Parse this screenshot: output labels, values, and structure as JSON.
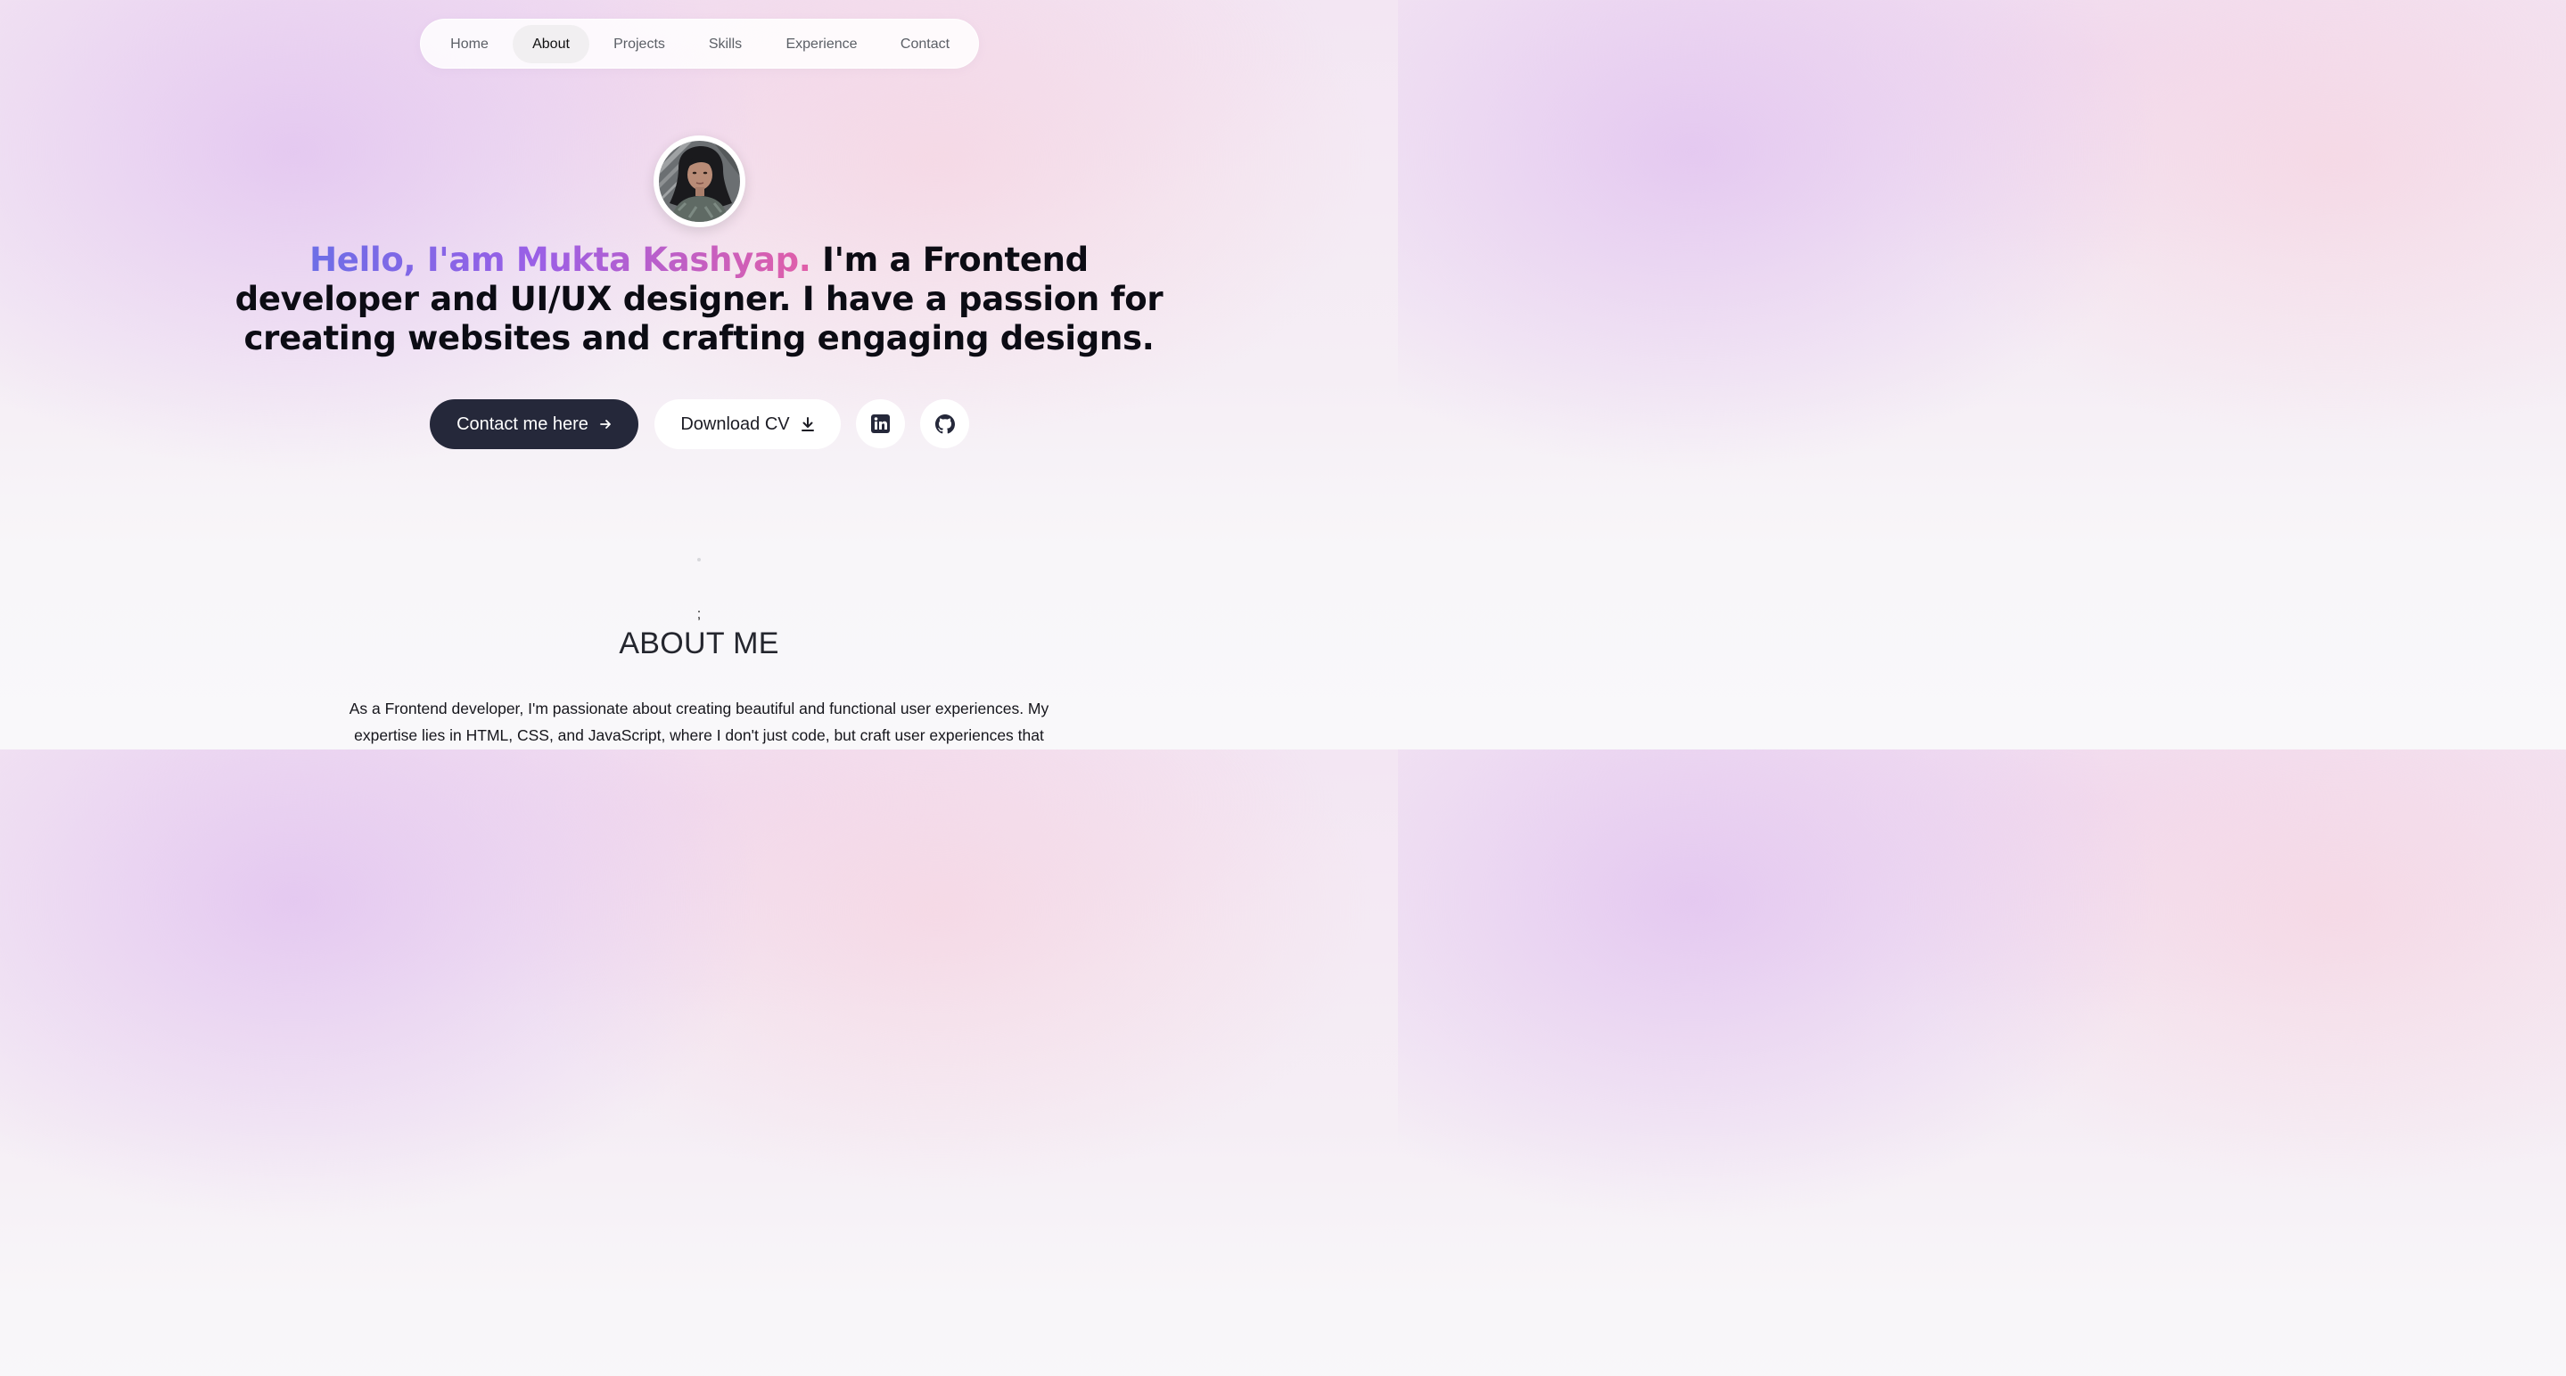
{
  "nav": {
    "items": [
      {
        "label": "Home"
      },
      {
        "label": "About",
        "active": true
      },
      {
        "label": "Projects"
      },
      {
        "label": "Skills"
      },
      {
        "label": "Experience"
      },
      {
        "label": "Contact"
      }
    ]
  },
  "hero": {
    "greeting": "Hello, I'am Mukta Kashyap.",
    "intro": " I'm a Frontend developer and UI/UX designer. I have a passion for creating websites and crafting engaging designs.",
    "gradient_colors": [
      "#6d6ee6",
      "#9a5fe6",
      "#e15fa8"
    ],
    "contact_button": {
      "label": "Contact me here",
      "icon": "arrow-right-icon"
    },
    "cv_button": {
      "label": "Download CV",
      "icon": "download-icon"
    },
    "social": [
      {
        "icon": "linkedin-icon"
      },
      {
        "icon": "github-icon"
      }
    ]
  },
  "about": {
    "separator": ";",
    "title": "ABOUT ME",
    "text": "As a Frontend developer, I'm passionate about creating beautiful and functional user experiences. My expertise lies in HTML, CSS, and JavaScript, where I don't just code, but craft user experiences that"
  },
  "colors": {
    "primary_button": "#25283a",
    "page_background": "#f5eef5"
  }
}
